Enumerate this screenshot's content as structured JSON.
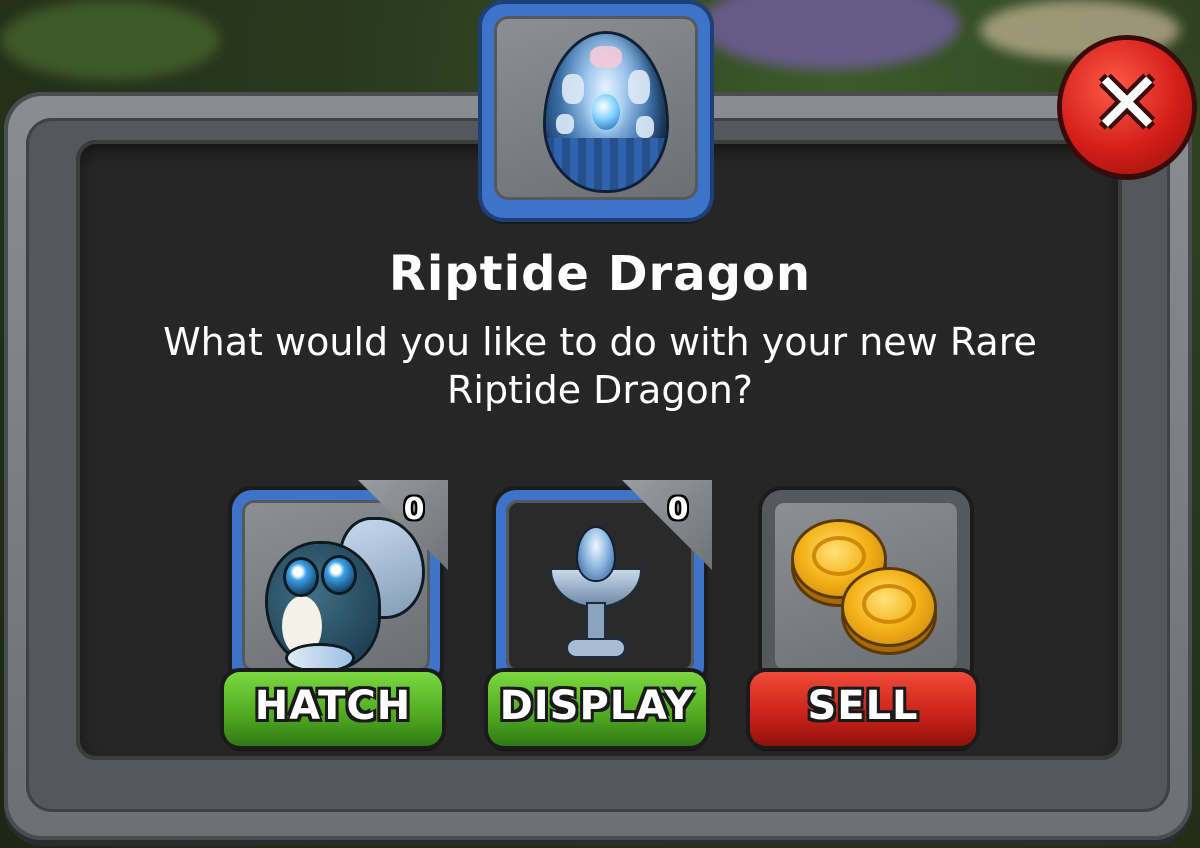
{
  "dialog": {
    "title": "Riptide Dragon",
    "message": "What would you like to do with your new Rare Riptide Dragon?",
    "close_glyph": "✕"
  },
  "options": [
    {
      "id": "hatch",
      "label": "HATCH",
      "count": "0",
      "icon": "riptide-dragon-icon",
      "color": "#4fa821"
    },
    {
      "id": "display",
      "label": "DISPLAY",
      "count": "0",
      "icon": "egg-fountain-icon",
      "color": "#4fa821"
    },
    {
      "id": "sell",
      "label": "SELL",
      "icon": "gold-coins-icon",
      "color": "#c82218"
    }
  ],
  "egg_icon": "riptide-egg-icon",
  "colors": {
    "card_blue": "#3d74c9",
    "panel": "#262626",
    "close_red": "#d41e18"
  }
}
